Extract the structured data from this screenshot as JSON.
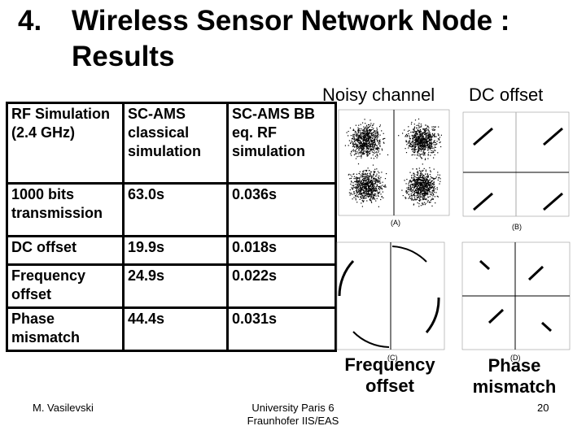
{
  "slide": {
    "number": "4.",
    "title": "Wireless Sensor Network Node : Results"
  },
  "table": {
    "headers": [
      "RF Simulation (2.4 GHz)",
      "SC-AMS classical simulation",
      "SC-AMS BB eq. RF simulation"
    ],
    "rows": [
      [
        "1000 bits transmission",
        "63.0s",
        "0.036s"
      ],
      [
        "DC offset",
        "19.9s",
        "0.018s"
      ],
      [
        "Frequency offset",
        "24.9s",
        "0.022s"
      ],
      [
        "Phase mismatch",
        "44.4s",
        "0.031s"
      ]
    ]
  },
  "plots": [
    {
      "caption": "Noisy channel",
      "label": "(A)",
      "kind": "noisy-constellation"
    },
    {
      "caption": "DC offset",
      "label": "(B)",
      "kind": "dc-offset-constellation"
    },
    {
      "caption": "Frequency offset",
      "label": "(C)",
      "kind": "frequency-offset-constellation"
    },
    {
      "caption": "Phase mismatch",
      "label": "(D)",
      "kind": "phase-mismatch-constellation"
    }
  ],
  "footer": {
    "author": "M. Vasilevski",
    "institution_line1": "University Paris 6",
    "institution_line2": "Fraunhofer IIS/EAS",
    "page": "20"
  }
}
